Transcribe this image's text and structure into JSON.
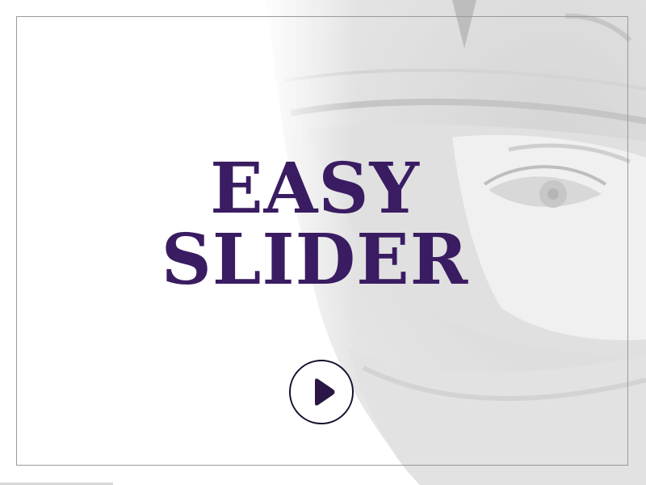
{
  "slide": {
    "title_line1": "EASY",
    "title_line2": "SLIDER",
    "progress_fraction": 0.175
  },
  "colors": {
    "title": "#3a1c62",
    "play_icon": "#2a1745",
    "frame": "#9a9a9a",
    "background": "#ffffff"
  },
  "icons": {
    "play": "play-icon"
  }
}
